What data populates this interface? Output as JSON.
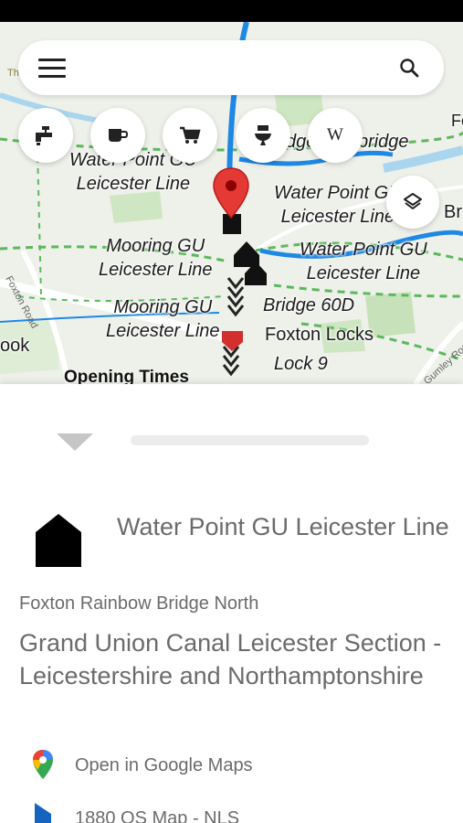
{
  "map": {
    "labels": {
      "wp_top": "Water Point GU\nLeicester Line",
      "footbridge": "dge Footbridge",
      "wp_right": "Water Point GU\nLeicester Line",
      "br": "Br",
      "mooring1": "Mooring GU\nLeicester Line",
      "wp_mid": "Water Point GU\nLeicester Line",
      "mooring2": "Mooring GU\nLeicester Line",
      "bridge60d": "Bridge 60D",
      "foxton_locks": "Foxton Locks",
      "lock9": "Lock 9",
      "ook": "ook",
      "fo": "Fo",
      "th": "Th"
    },
    "roads": {
      "foxton_road": "Foxton Road",
      "gumley_road": "Gumley Road"
    },
    "opening_times": "Opening Times",
    "colors": {
      "canal": "#1e88e5",
      "path": "#5cb85c",
      "water": "#a9d6ee",
      "marker": "#e53935"
    }
  },
  "search": {
    "placeholder": ""
  },
  "filters": [
    {
      "name": "water-tap-icon"
    },
    {
      "name": "cafe-icon"
    },
    {
      "name": "shop-cart-icon"
    },
    {
      "name": "toilet-icon"
    },
    {
      "name": "wikipedia",
      "text": "W"
    }
  ],
  "poi": {
    "title": "Water Point GU Leicester Line",
    "location": "Foxton Rainbow Bridge North",
    "waterway": "Grand Union Canal Leicester Section - Leicestershire and Northamptonshire",
    "links": [
      {
        "label": "Open in Google Maps",
        "icon": "google-maps-pin-icon"
      },
      {
        "label": "1880 OS Map - NLS",
        "icon": "nls-map-icon"
      }
    ]
  }
}
